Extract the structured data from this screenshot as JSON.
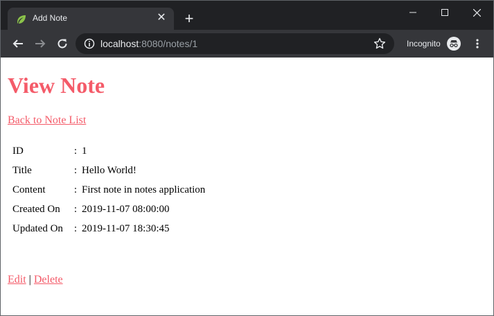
{
  "browser": {
    "tab_title": "Add Note",
    "tab_close": "✕",
    "new_tab": "+",
    "url_host": "localhost",
    "url_rest": ":8080/notes/1",
    "incognito_label": "Incognito"
  },
  "page": {
    "heading": "View Note",
    "back_link": "Back to Note List",
    "separator": ":",
    "fields": [
      {
        "label": "ID",
        "value": "1"
      },
      {
        "label": "Title",
        "value": "Hello World!"
      },
      {
        "label": "Content",
        "value": "First note in notes application"
      },
      {
        "label": "Created On",
        "value": "2019-11-07 08:00:00"
      },
      {
        "label": "Updated On",
        "value": "2019-11-07 18:30:45"
      }
    ],
    "edit_link": "Edit",
    "pipe": "|",
    "delete_link": "Delete"
  },
  "colors": {
    "accent": "#f45b69",
    "titlebar": "#202124",
    "toolbar": "#35363a"
  }
}
